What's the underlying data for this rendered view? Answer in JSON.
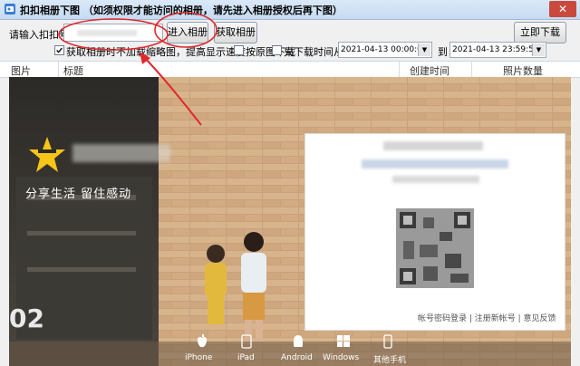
{
  "window": {
    "title": "扣扣相册下图 （如须权限才能访问的相册，请先进入相册授权后再下图）",
    "close_label": "✕"
  },
  "toolbar": {
    "qq_label": "请输入扣扣号:",
    "qq_value": "",
    "enter_album_button": "进入相册",
    "get_album_button": "获取相册",
    "download_now_button": "立即下载",
    "option_skip_thumb": "获取相册时不加载缩略图，提高显示速度",
    "option_skip_thumb_checked": true,
    "option_by_album": "按原图下载",
    "option_by_album_checked": false,
    "option_time_filter": "只下载时间从:",
    "option_time_filter_checked": false,
    "time_from": "2021-04-13 00:00:00",
    "time_to_label": "到",
    "time_to": "2021-04-13 23:59:59"
  },
  "table": {
    "columns": [
      "图片",
      "标题",
      "创建时间",
      "照片数量"
    ]
  },
  "login_page": {
    "brand_slogan": "分享生活   留住感动",
    "year_text": "02",
    "login_links": "帐号密码登录  |  注册新帐号  |  意见反馈",
    "platforms": [
      "iPhone",
      "iPad",
      "Android",
      "Windows",
      "其他手机"
    ]
  },
  "colors": {
    "annotation_red": "#e0282c",
    "title_bg": "#c6dbf2",
    "close_red": "#c94a3c"
  },
  "icons": [
    "app-icon",
    "close-icon",
    "star-logo-icon",
    "apple-icon",
    "ipad-icon",
    "android-icon",
    "windows-icon",
    "phone-icon",
    "qr-code-icon"
  ]
}
